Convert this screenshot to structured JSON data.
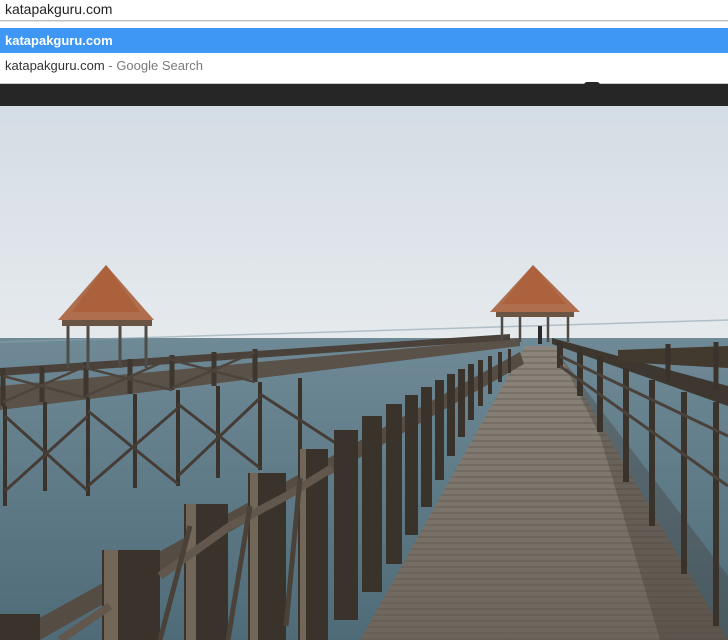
{
  "omnibox": {
    "url": "katapakguru.com"
  },
  "suggestions": [
    {
      "text": "katapakguru.com"
    },
    {
      "text": "katapakguru.com",
      "separator": "-",
      "engine": "Google Search"
    }
  ],
  "colors": {
    "selected_bg": "#3e97f5",
    "sky": "#dfe5ea",
    "sea": "#5d7a87",
    "roof": "#b8673f",
    "wood_dark": "#3f3a33"
  },
  "image": {
    "subject": "wooden pier with gazebos over sea"
  }
}
